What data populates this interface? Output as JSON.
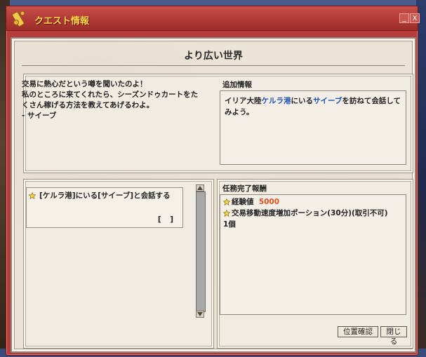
{
  "window": {
    "title": "クエスト情報",
    "minimize_label": "_",
    "close_label": "X"
  },
  "quest": {
    "title": "より広い世界",
    "dialog": "交易に熱心だという噂を聞いたのよ！\n私のところに来てくれたら、シーズンドゥカートをたくさん稼げる方法を教えてあげるわよ。\n- サイーブ"
  },
  "additional_info": {
    "label": "追加情報",
    "text_before": "イリア大陸",
    "place": "ケルラ港",
    "text_middle": "にいる",
    "npc": "サイーブ",
    "text_after": "を訪ねて会話してみよう。"
  },
  "objective": {
    "text": "[ケルラ港]にいる[サイーブ]と会話する",
    "status": "[　]"
  },
  "rewards": {
    "label": "任務完了報酬",
    "exp_label": "経験値",
    "exp_value": "5000",
    "item_name": "交易移動速度増加ポーション(30分)(取引不可)",
    "item_count": "1個"
  },
  "buttons": {
    "locate": "位置確認",
    "close": "閉じる"
  },
  "colors": {
    "title_bar": "#b53c3a",
    "title_text": "#ffd84a",
    "link_blue": "#1e50b4",
    "exp_orange": "#e2501e",
    "parchment": "#ebe4d6"
  }
}
